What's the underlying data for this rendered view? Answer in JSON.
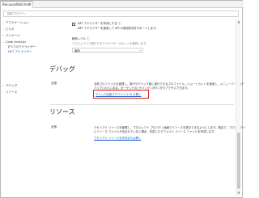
{
  "window": {
    "tab_title": "BecauseWatched",
    "tab_close": "×"
  },
  "search": {
    "placeholder": "検索プロパティ"
  },
  "sidebar": {
    "items": [
      {
        "label": "アプリケーション",
        "arrow": "›"
      },
      {
        "label": "ビルド",
        "arrow": "›"
      },
      {
        "label": "パッケージ",
        "arrow": "›"
      },
      {
        "label": "Code Analysis",
        "arrow": "⌄"
      },
      {
        "label": "すべてのアナライザー"
      },
      {
        "label": ".NET アナライザー"
      },
      {
        "label": "デバッグ",
        "arrow": "›"
      },
      {
        "label": "リソース",
        "arrow": "›"
      }
    ]
  },
  "analysis": {
    "net_analyzer_heading": ".NET アナライザーを有効にする ⓘ",
    "net_analyzer_desc": ".NET アナライザーを使用して API の使用状況をサポートします。",
    "analysis_level_label": "解析レベル ⓘ",
    "analysis_level_desc": "プロジェクトで実行するアナライザーのセットを選択します。",
    "analysis_level_value": "最新"
  },
  "debug": {
    "section_title": "デバッグ",
    "general_label": "全般",
    "description_1": "全般プロファイルを管理し、実行やデバッグ時に実行できるプロファイル。ショートカットを使用し、メニューバーの [デ",
    "description_2": "バッグ] の上にある。ターゲットの [デバッグ] ボタンからアクセスできます。",
    "link_text": "デバッグ起動プロファイル UI を開く"
  },
  "resources": {
    "section_title": "リソース",
    "general_label": "全般",
    "description_1": "アセンブリ リソースを管理し、プロジェクト プロパティ画面でリソースを表示できるようにします。既定で、プロジェクト",
    "description_2": "にリソース ファイルが含まれていない場合、作成したデフォルト リソース ファイルを作成します。",
    "link_text": "アセンブリ リソースを作成または開く"
  },
  "scrollbar": {
    "up": "▲",
    "down": "▼"
  },
  "colors": {
    "accent": "#1a62c5",
    "highlight_box": "#e02020"
  }
}
